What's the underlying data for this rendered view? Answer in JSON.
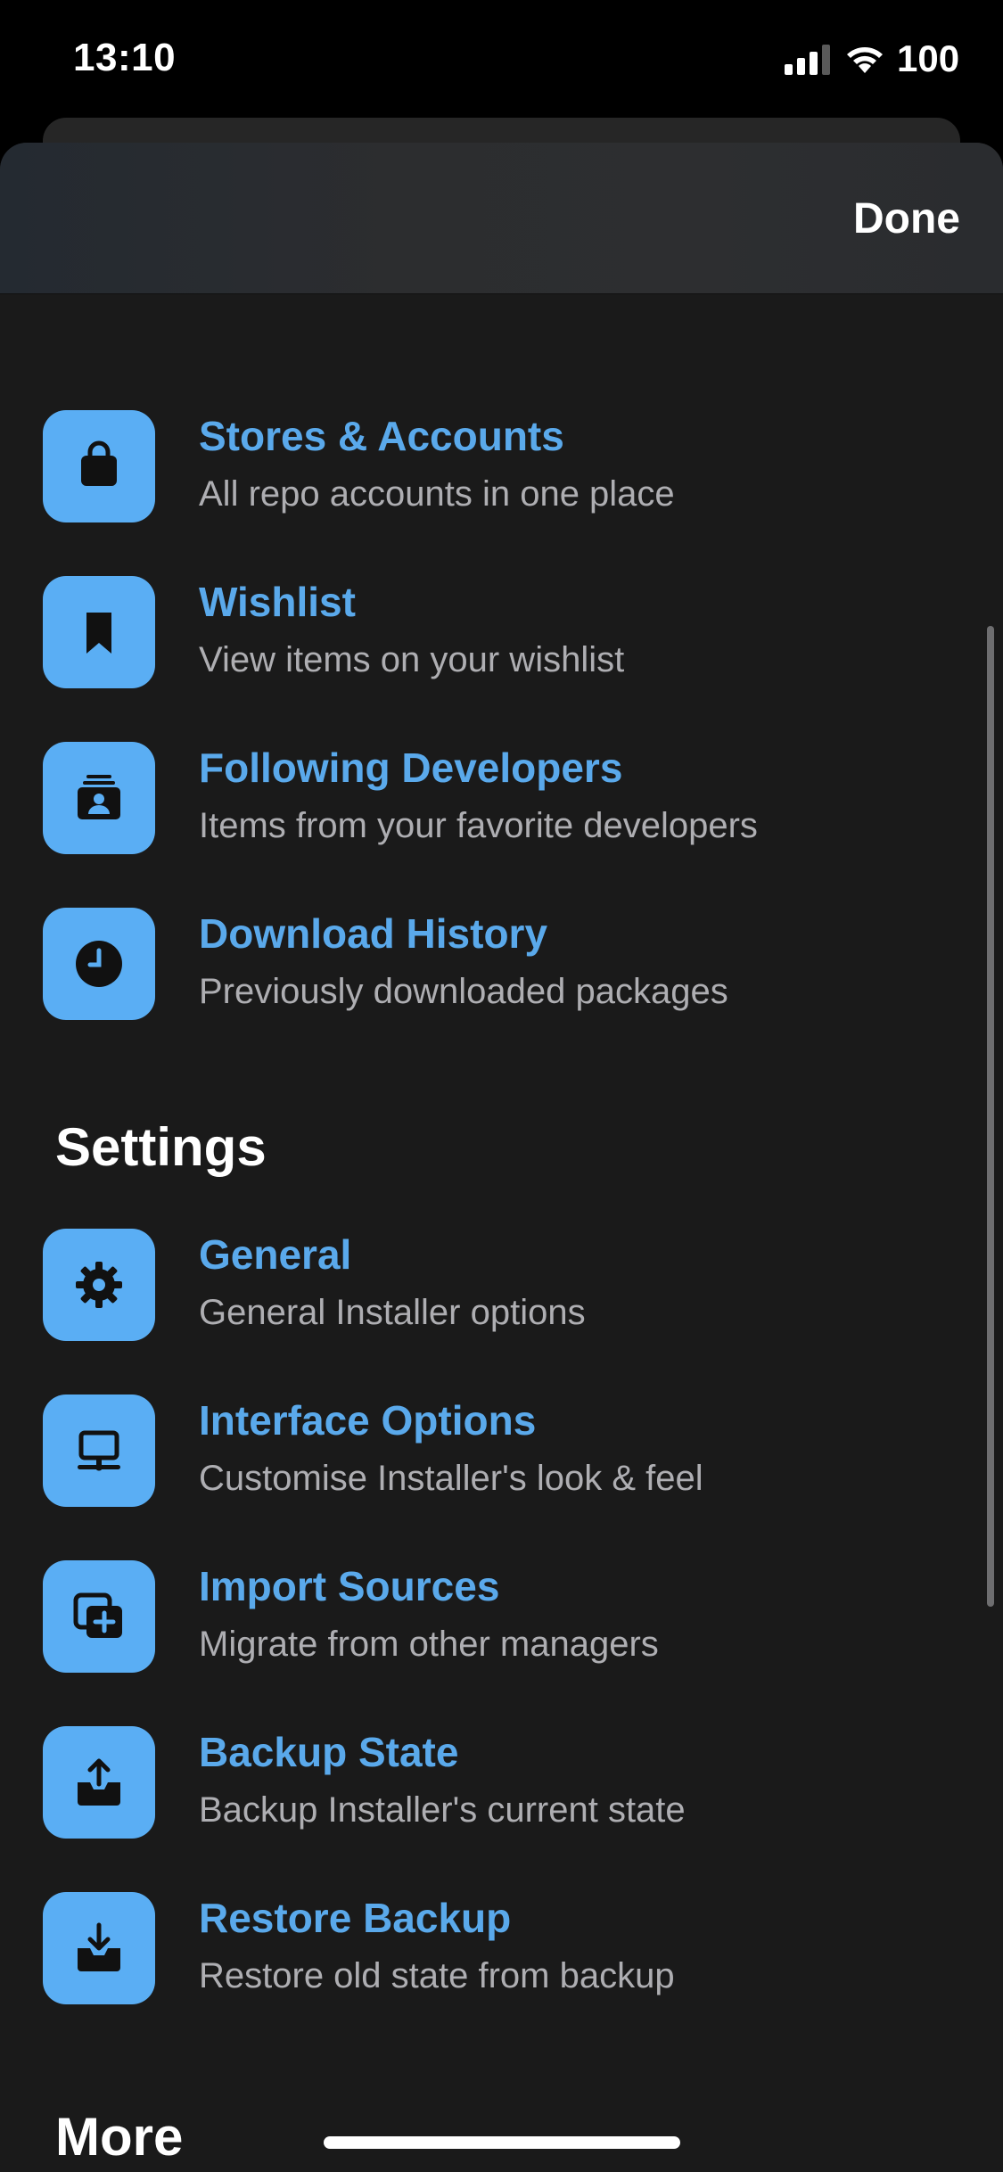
{
  "status": {
    "time": "13:10",
    "battery": "100"
  },
  "header": {
    "done_label": "Done"
  },
  "account_items": [
    {
      "title": "Stores & Accounts",
      "subtitle": "All repo accounts in one place",
      "icon": "bag-icon"
    },
    {
      "title": "Wishlist",
      "subtitle": "View items on your wishlist",
      "icon": "bookmark-icon"
    },
    {
      "title": "Following Developers",
      "subtitle": "Items from your favorite developers",
      "icon": "person-card-icon"
    },
    {
      "title": "Download History",
      "subtitle": "Previously downloaded packages",
      "icon": "clock-icon"
    }
  ],
  "settings": {
    "heading": "Settings",
    "items": [
      {
        "title": "General",
        "subtitle": "General Installer options",
        "icon": "gear-icon"
      },
      {
        "title": "Interface Options",
        "subtitle": "Customise Installer's look & feel",
        "icon": "display-icon"
      },
      {
        "title": "Import Sources",
        "subtitle": "Migrate from other managers",
        "icon": "stack-plus-icon"
      },
      {
        "title": "Backup State",
        "subtitle": "Backup Installer's current state",
        "icon": "tray-upload-icon"
      },
      {
        "title": "Restore Backup",
        "subtitle": "Restore old state from backup",
        "icon": "tray-download-icon"
      }
    ]
  },
  "more": {
    "heading": "More"
  },
  "colors": {
    "accent": "#5aa9eb",
    "icon_bg": "#5aaef4",
    "background": "#1a1a1a",
    "subtitle": "#aeaeb2"
  }
}
